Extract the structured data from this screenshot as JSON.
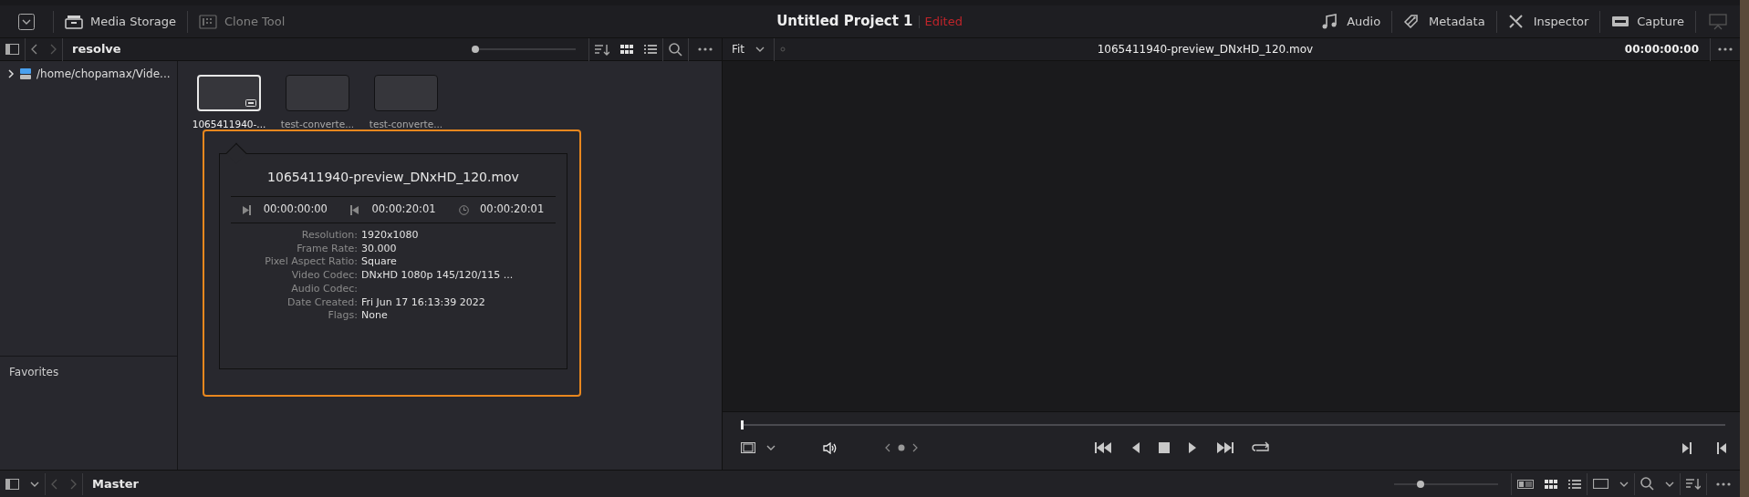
{
  "toolbar": {
    "left_tools": [
      {
        "label": "Media Storage",
        "disabled": false
      },
      {
        "label": "Clone Tool",
        "disabled": true
      }
    ],
    "project_title": "Untitled Project 1",
    "project_status": "Edited",
    "right_tools": [
      {
        "label": "Audio",
        "kind": "audio"
      },
      {
        "label": "Metadata",
        "kind": "metadata"
      },
      {
        "label": "Inspector",
        "kind": "inspector"
      },
      {
        "label": "Capture",
        "kind": "capture"
      }
    ]
  },
  "media_pool_bar": {
    "path": "resolve",
    "level": 0.0
  },
  "viewer_bar": {
    "zoom": "Fit",
    "clip_name": "1065411940-preview_DNxHD_120.mov",
    "timecode": "00:00:00:00"
  },
  "sidebar": {
    "items": [
      {
        "label": "/home/chopamax/Vide...",
        "expanded": false
      }
    ],
    "favorites_label": "Favorites"
  },
  "clips": [
    {
      "label": "1065411940-...",
      "selected": true
    },
    {
      "label": "test-converte...",
      "selected": false
    },
    {
      "label": "test-converte...",
      "selected": false
    }
  ],
  "clip_info": {
    "title": "1065411940-preview_DNxHD_120.mov",
    "timecodes": [
      {
        "kind": "start",
        "value": "00:00:00:00"
      },
      {
        "kind": "end",
        "value": "00:00:20:01"
      },
      {
        "kind": "duration",
        "value": "00:00:20:01"
      }
    ],
    "properties": [
      {
        "label": "Resolution:",
        "value": "1920x1080"
      },
      {
        "label": "Frame Rate:",
        "value": "30.000"
      },
      {
        "label": "Pixel Aspect Ratio:",
        "value": "Square"
      },
      {
        "label": "Video Codec:",
        "value": "DNxHD 1080p 145/120/115 ..."
      },
      {
        "label": "Audio Codec:"
      },
      {
        "label": "Date Created:",
        "value": "Fri Jun 17 16:13:39 2022"
      },
      {
        "label": "Flags:",
        "value": "None"
      }
    ]
  },
  "transport": {
    "level": 0.0
  },
  "bottom_bar": {
    "bin": "Master",
    "level": 0.25
  }
}
